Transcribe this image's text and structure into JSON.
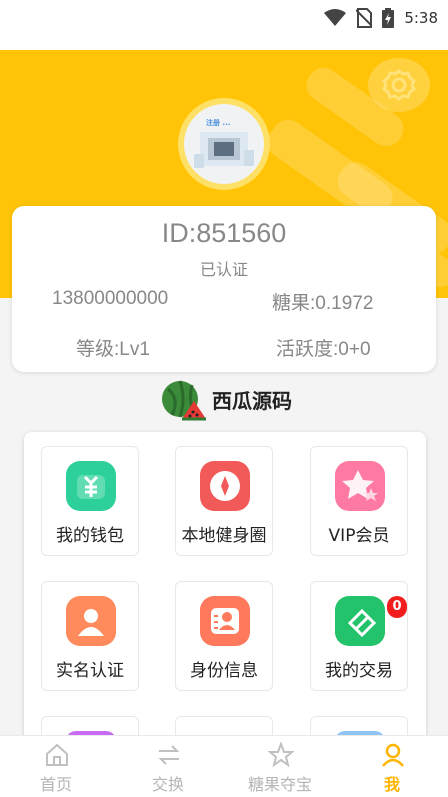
{
  "status_bar": {
    "time": "5:38",
    "icons": [
      "wifi-icon",
      "no-sim-icon",
      "battery-charging-icon"
    ]
  },
  "header": {
    "settings_icon": "gear-icon",
    "accent_color": "#ffc408"
  },
  "profile": {
    "avatar_caption": "注册 ...",
    "id_label": "ID:851560",
    "verification_status": "已认证",
    "phone": "13800000000",
    "candy_label": "糖果:0.1972",
    "level_label": "等级:Lv1",
    "activity_label": "活跃度:0+0"
  },
  "brand": {
    "name": "西瓜源码",
    "icon": "watermelon-logo-icon"
  },
  "menu": {
    "items": [
      {
        "label": "我的钱包",
        "icon": "wallet-icon",
        "color": "#2dd09a"
      },
      {
        "label": "本地健身圈",
        "icon": "fitness-circle-icon",
        "color": "#f25a5a"
      },
      {
        "label": "VIP会员",
        "icon": "vip-star-icon",
        "color": "#ff7aa2"
      },
      {
        "label": "实名认证",
        "icon": "user-verify-icon",
        "color": "#ff8a5c"
      },
      {
        "label": "身份信息",
        "icon": "id-card-icon",
        "color": "#ff7a5c"
      },
      {
        "label": "我的交易",
        "icon": "transaction-icon",
        "color": "#22c36a"
      }
    ],
    "transaction_badge": "0"
  },
  "tabbar": {
    "tabs": [
      {
        "label": "首页",
        "icon": "home-icon"
      },
      {
        "label": "交换",
        "icon": "exchange-icon"
      },
      {
        "label": "糖果夺宝",
        "icon": "star-icon"
      },
      {
        "label": "我",
        "icon": "user-icon"
      }
    ],
    "active_index": 3,
    "active_color": "#ffb400"
  }
}
